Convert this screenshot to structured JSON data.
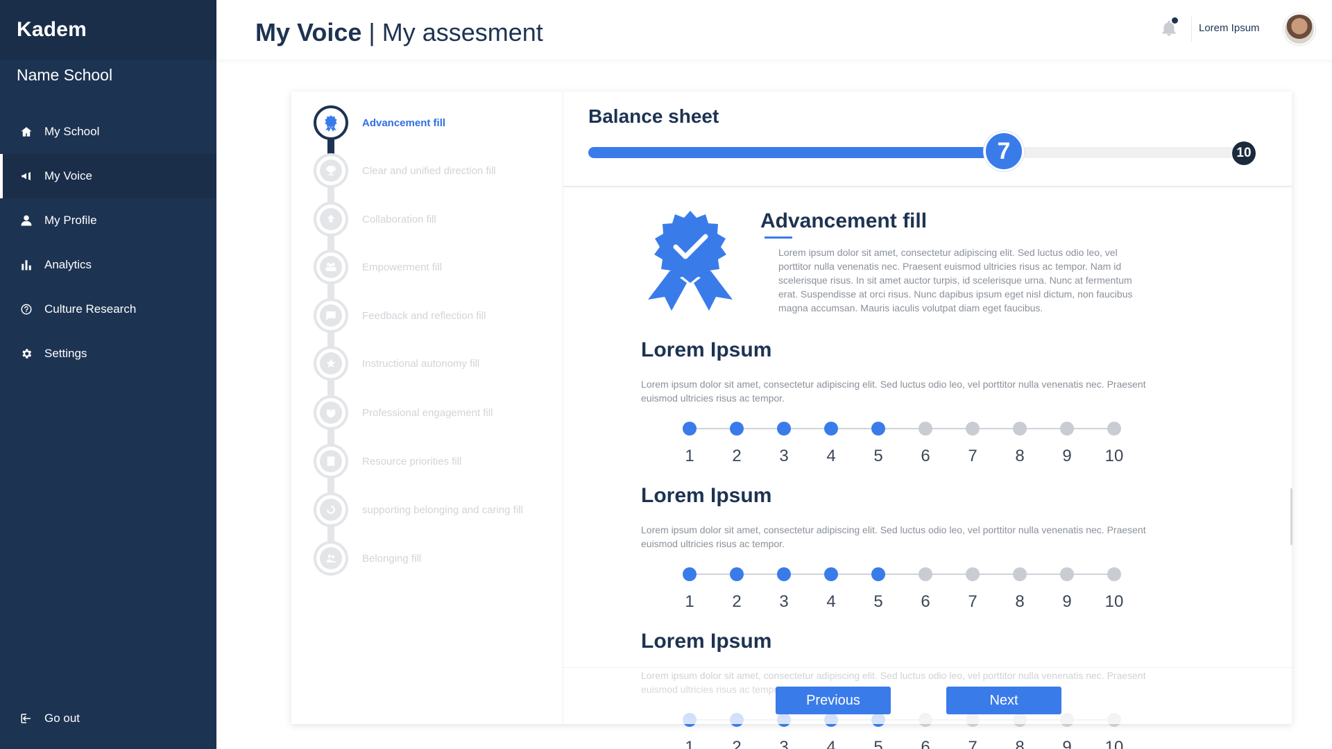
{
  "sidebar": {
    "brand": "Kadem",
    "school": "Name School",
    "items": [
      {
        "label": "My School",
        "icon": "home-icon"
      },
      {
        "label": "My Voice",
        "icon": "megaphone-icon"
      },
      {
        "label": "My Profile",
        "icon": "user-icon"
      },
      {
        "label": "Analytics",
        "icon": "bar-chart-icon"
      },
      {
        "label": "Culture Research",
        "icon": "question-circle-icon"
      },
      {
        "label": "Settings",
        "icon": "gear-icon"
      }
    ],
    "active_item": "My Voice",
    "logout": "Go out"
  },
  "header": {
    "title_bold": "My Voice",
    "title_rest": " | My assesment",
    "user_name": "Lorem Ipsum"
  },
  "steps": {
    "active_index": 0,
    "items": [
      {
        "label": "Advancement fill",
        "icon": "award-icon"
      },
      {
        "label": "Clear and unified direction fill",
        "icon": "trophy-icon"
      },
      {
        "label": "Collaboration fill",
        "icon": "upload-icon"
      },
      {
        "label": "Empowerment fill",
        "icon": "group-icon"
      },
      {
        "label": "Feedback and reflection fill",
        "icon": "chat-icon"
      },
      {
        "label": "Instructional autonomy fill",
        "icon": "star-badge-icon"
      },
      {
        "label": "Professional engagement fill",
        "icon": "handshake-icon"
      },
      {
        "label": "Resource priorities fill",
        "icon": "checklist-icon"
      },
      {
        "label": "supporting belonging and caring fill",
        "icon": "hand-care-icon"
      },
      {
        "label": "Belonging fill",
        "icon": "people-icon"
      }
    ]
  },
  "balance": {
    "title": "Balance sheet",
    "value": 7,
    "value_label": "7",
    "max": 10,
    "max_label": "10",
    "accent": "#3a7bea"
  },
  "section": {
    "title": "Advancement fill",
    "icon": "award-ribbon-icon",
    "description": "Lorem ipsum dolor sit amet, consectetur adipiscing elit. Sed luctus odio leo, vel porttitor nulla venenatis nec. Praesent euismod ultricies risus ac tempor. Nam id scelerisque risus. In sit amet auctor turpis, id scelerisque urna. Nunc at fermentum erat. Suspendisse at orci risus. Nunc dapibus ipsum eget nisl dictum, non faucibus magna accumsan. Mauris iaculis volutpat diam eget faucibus."
  },
  "questions": [
    {
      "title": "Lorem Ipsum",
      "text": "Lorem ipsum dolor sit amet, consectetur adipiscing elit. Sed luctus odio leo, vel porttitor nulla venenatis nec. Praesent euismod ultricies risus ac tempor.",
      "selected": 5
    },
    {
      "title": "Lorem Ipsum",
      "text": "Lorem ipsum dolor sit amet, consectetur adipiscing elit. Sed luctus odio leo, vel porttitor nulla venenatis nec. Praesent euismod ultricies risus ac tempor.",
      "selected": 5
    },
    {
      "title": "Lorem Ipsum",
      "text": "Lorem ipsum dolor sit amet, consectetur adipiscing elit. Sed luctus odio leo, vel porttitor nulla venenatis nec. Praesent euismod ultricies risus ac tempor.",
      "selected": 5
    }
  ],
  "scale_labels": [
    "1",
    "2",
    "3",
    "4",
    "5",
    "6",
    "7",
    "8",
    "9",
    "10"
  ],
  "buttons": {
    "previous": "Previous",
    "next": "Next"
  }
}
